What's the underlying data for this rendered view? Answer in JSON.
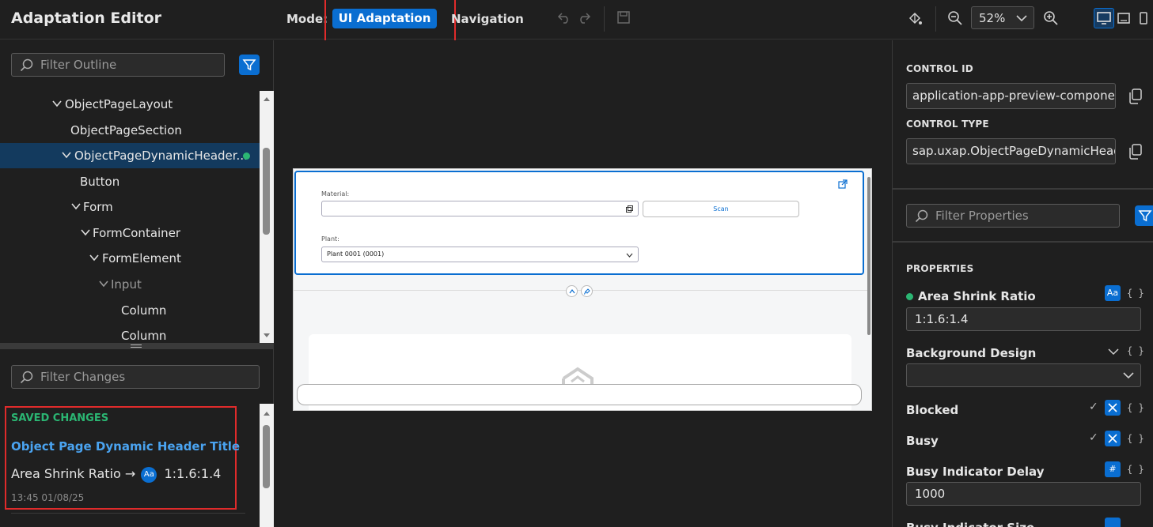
{
  "app": {
    "title": "Adaptation Editor"
  },
  "toolbar": {
    "mode_label": "Mode:",
    "mode_active": "UI Adaptation",
    "mode_other": "Navigation",
    "zoom_value": "52%"
  },
  "outline": {
    "filter_placeholder": "Filter Outline",
    "items": [
      {
        "label": "ObjectPageLayout"
      },
      {
        "label": "ObjectPageSection"
      },
      {
        "label": "ObjectPageDynamicHeader..."
      },
      {
        "label": "Button"
      },
      {
        "label": "Form"
      },
      {
        "label": "FormContainer"
      },
      {
        "label": "FormElement"
      },
      {
        "label": "Input"
      },
      {
        "label": "Column"
      },
      {
        "label": "Column"
      }
    ]
  },
  "changes": {
    "filter_placeholder": "Filter Changes",
    "section_title": "SAVED CHANGES",
    "change_title": "Object Page Dynamic Header Title",
    "property": "Area Shrink Ratio",
    "arrow": "→",
    "badge": "Aa",
    "value": "1:1.6:1.4",
    "timestamp": "13:45 01/08/25"
  },
  "preview": {
    "material_label": "Material:",
    "scan_label": "Scan",
    "plant_label": "Plant:",
    "plant_value": "Plant 0001 (0001)"
  },
  "properties": {
    "control_id_label": "CONTROL ID",
    "control_id_value": "application-app-preview-compone...",
    "control_type_label": "CONTROL TYPE",
    "control_type_value": "sap.uxap.ObjectPageDynamicHeade...",
    "filter_placeholder": "Filter Properties",
    "section_title": "PROPERTIES",
    "area_shrink_ratio": "Area Shrink Ratio",
    "area_shrink_value": "1:1.6:1.4",
    "aa_badge": "Aa",
    "braces": "{ }",
    "background_design": "Background Design",
    "blocked": "Blocked",
    "busy": "Busy",
    "busy_delay": "Busy Indicator Delay",
    "hash_badge": "#",
    "busy_delay_value": "1000",
    "busy_size": "Busy Indicator Size",
    "checkmark": "✓"
  },
  "colors": {
    "accent": "#0a6ed1",
    "success": "#2bb673",
    "highlight": "#e02b2b",
    "link": "#4aa3f0"
  }
}
